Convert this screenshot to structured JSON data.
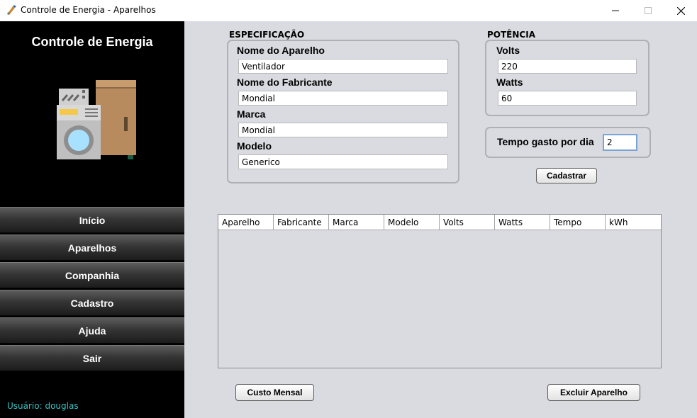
{
  "window": {
    "title": "Controle de Energia - Aparelhos"
  },
  "sidebar": {
    "brand": "Controle de Energia",
    "illustration_icon": "appliances-icon",
    "nav": [
      "Início",
      "Aparelhos",
      "Companhia",
      "Cadastro",
      "Ajuda",
      "Sair"
    ],
    "user_label": "Usuário: douglas"
  },
  "especificacao": {
    "title": "ESPECIFICAÇÃO",
    "fields": [
      {
        "label": "Nome do Aparelho",
        "value": "Ventilador"
      },
      {
        "label": "Nome do Fabricante",
        "value": "Mondial"
      },
      {
        "label": "Marca",
        "value": "Mondial"
      },
      {
        "label": "Modelo",
        "value": "Generico"
      }
    ]
  },
  "potencia": {
    "title": "POTÊNCIA",
    "fields": [
      {
        "label": "Volts",
        "value": "220"
      },
      {
        "label": "Watts",
        "value": "60"
      }
    ]
  },
  "tempo": {
    "label": "Tempo gasto por dia",
    "value": "2"
  },
  "buttons": {
    "cadastrar": "Cadastrar",
    "custo_mensal": "Custo Mensal",
    "excluir": "Excluir Aparelho"
  },
  "table": {
    "columns": [
      "Aparelho",
      "Fabricante",
      "Marca",
      "Modelo",
      "Volts",
      "Watts",
      "Tempo",
      "kWh"
    ],
    "rows": []
  },
  "colors": {
    "sidebar_bg": "#000000",
    "main_bg": "#d9dbe0",
    "user_text": "#37c4c4"
  }
}
